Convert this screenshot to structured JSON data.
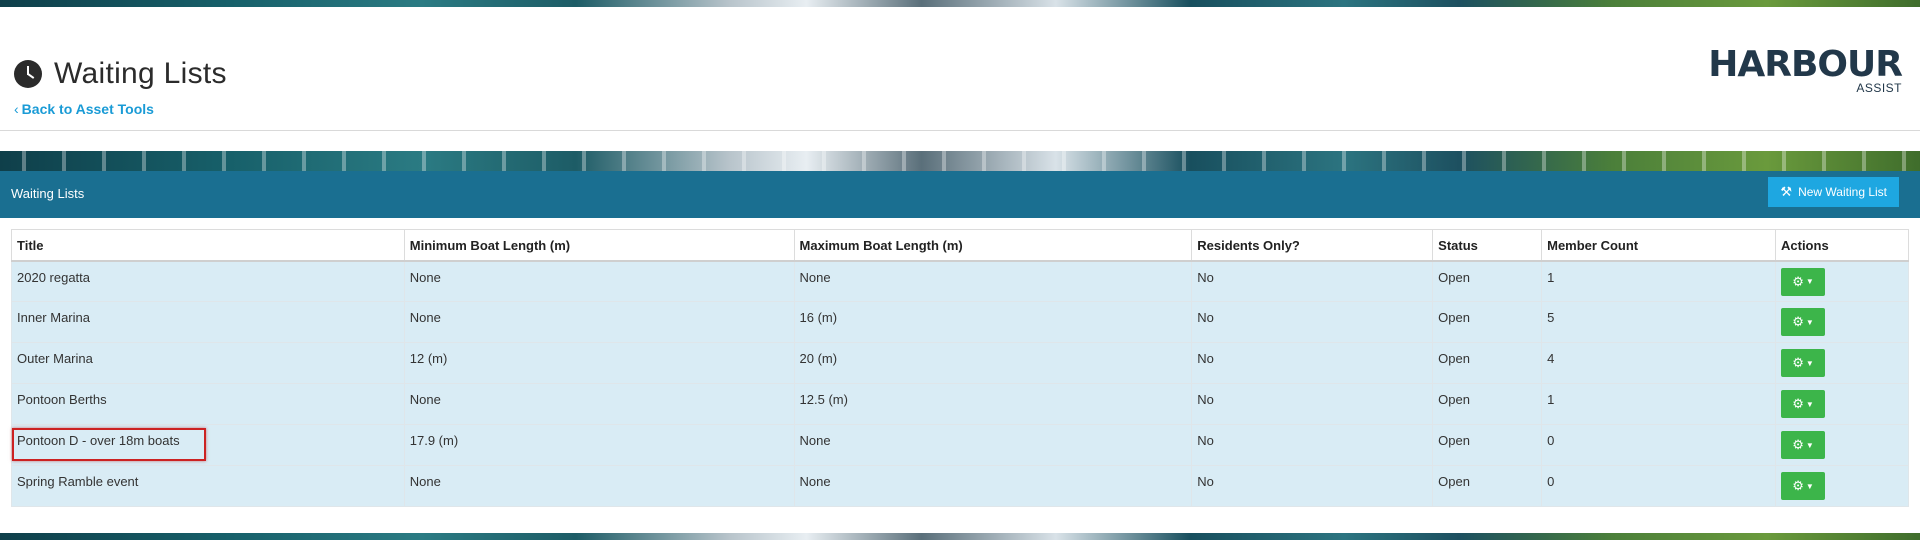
{
  "header": {
    "title": "Waiting Lists",
    "back_link": "Back to Asset Tools",
    "logo_main": "HARBOUR",
    "logo_sub": "ASSIST"
  },
  "panel": {
    "title": "Waiting Lists",
    "new_button": "New Waiting List"
  },
  "table": {
    "columns": [
      "Title",
      "Minimum Boat Length (m)",
      "Maximum Boat Length (m)",
      "Residents Only?",
      "Status",
      "Member Count",
      "Actions"
    ],
    "rows": [
      {
        "title": "2020 regatta",
        "min": "None",
        "max": "None",
        "residents": "No",
        "status": "Open",
        "count": "1"
      },
      {
        "title": "Inner Marina",
        "min": "None",
        "max": "16 (m)",
        "residents": "No",
        "status": "Open",
        "count": "5"
      },
      {
        "title": "Outer Marina",
        "min": "12 (m)",
        "max": "20 (m)",
        "residents": "No",
        "status": "Open",
        "count": "4"
      },
      {
        "title": "Pontoon Berths",
        "min": "None",
        "max": "12.5 (m)",
        "residents": "No",
        "status": "Open",
        "count": "1"
      },
      {
        "title": "Pontoon D - over 18m boats",
        "min": "17.9 (m)",
        "max": "None",
        "residents": "No",
        "status": "Open",
        "count": "0"
      },
      {
        "title": "Spring Ramble event",
        "min": "None",
        "max": "None",
        "residents": "No",
        "status": "Open",
        "count": "0"
      }
    ]
  },
  "colors": {
    "panel_header": "#1a6f91",
    "new_button": "#1ea7e1",
    "action_button": "#3cb54a",
    "row_background": "#d9ecf5",
    "link": "#1a9bd6",
    "highlight": "#cc2222"
  },
  "icons": {
    "title": "clock-icon",
    "back": "chevron-left-icon",
    "new_button": "magic-wand-icon",
    "action": "gear-icon"
  }
}
